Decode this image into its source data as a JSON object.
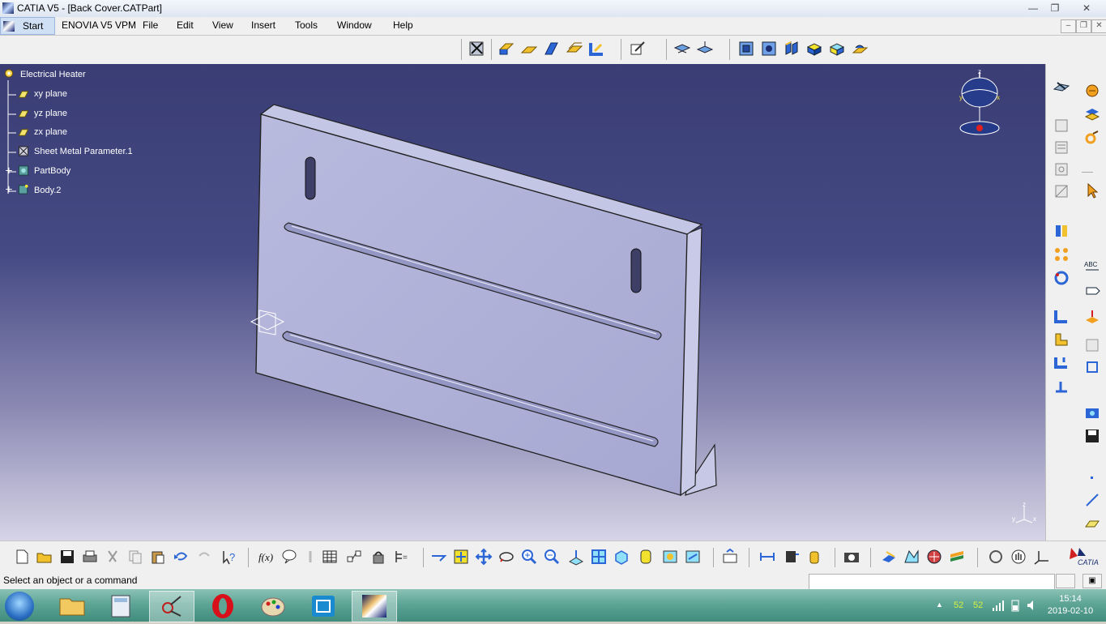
{
  "window": {
    "title": "CATIA V5 - [Back Cover.CATPart]"
  },
  "menu": {
    "start": "Start",
    "items": [
      "ENOVIA V5 VPM",
      "File",
      "Edit",
      "View",
      "Insert",
      "Tools",
      "Window",
      "Help"
    ]
  },
  "tree": {
    "root": "Electrical Heater",
    "items": [
      "xy plane",
      "yz plane",
      "zx plane",
      "Sheet Metal Parameter.1",
      "PartBody",
      "Body.2"
    ]
  },
  "compass": {
    "labels": [
      "z",
      "y",
      "x"
    ]
  },
  "axis_triad": {
    "labels": [
      "z",
      "y",
      "x"
    ]
  },
  "status": {
    "message": "Select an object or a command",
    "command_input": ""
  },
  "taskbar": {
    "clock_time": "15:14",
    "clock_date": "2019-02-10",
    "tray_temp1": "52",
    "tray_temp2": "52"
  },
  "brand": {
    "logo_text": "CATIA"
  },
  "colors": {
    "viewport_top": "#3a3d74",
    "viewport_bottom": "#d6d4e6",
    "part_face": "#aeb0d8",
    "taskbar": "#5ea596"
  }
}
